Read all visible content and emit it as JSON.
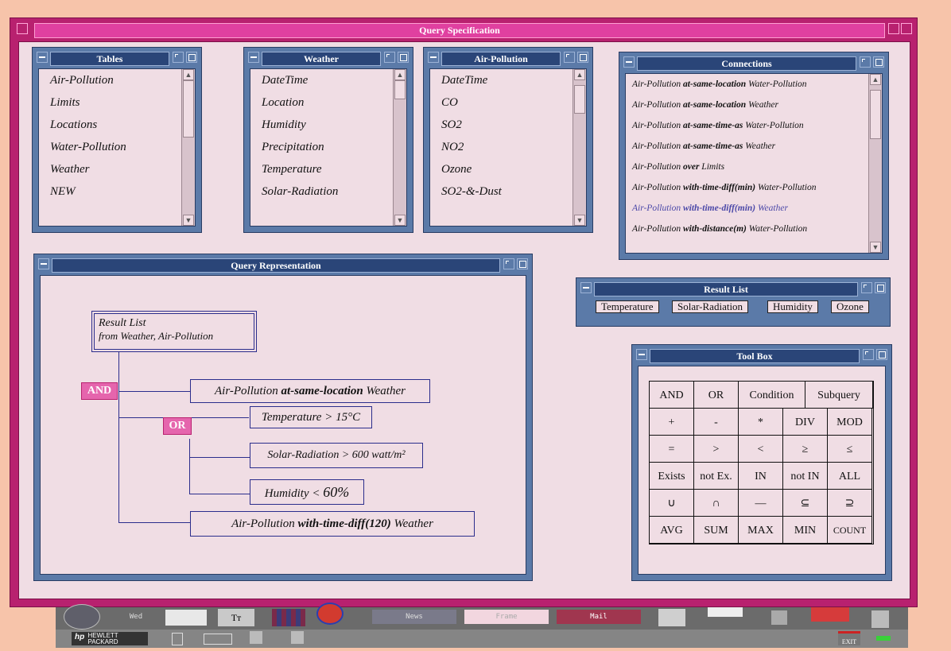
{
  "window": {
    "title": "Query Specification"
  },
  "tables": {
    "title": "Tables",
    "items": [
      "Air-Pollution",
      "Limits",
      "Locations",
      "Water-Pollution",
      "Weather",
      "NEW"
    ]
  },
  "weather": {
    "title": "Weather",
    "items": [
      "DateTime",
      "Location",
      "Humidity",
      "Precipitation",
      "Temperature",
      "Solar-Radiation"
    ]
  },
  "air_pollution": {
    "title": "Air-Pollution",
    "items": [
      "DateTime",
      "CO",
      "SO2",
      "NO2",
      "Ozone",
      "SO2-&-Dust"
    ]
  },
  "connections": {
    "title": "Connections",
    "items": [
      {
        "a": "Air-Pollution",
        "rel": "at-same-location",
        "b": "Water-Pollution"
      },
      {
        "a": "Air-Pollution",
        "rel": "at-same-location",
        "b": "Weather"
      },
      {
        "a": "Air-Pollution",
        "rel": "at-same-time-as",
        "b": "Water-Pollution"
      },
      {
        "a": "Air-Pollution",
        "rel": "at-same-time-as",
        "b": "Weather"
      },
      {
        "a": "Air-Pollution",
        "rel": "over",
        "b": "Limits"
      },
      {
        "a": "Air-Pollution",
        "rel": "with-time-diff(min)",
        "b": "Water-Pollution"
      },
      {
        "a": "Air-Pollution",
        "rel": "with-time-diff(min)",
        "b": "Weather"
      },
      {
        "a": "Air-Pollution",
        "rel": "with-distance(m)",
        "b": "Water-Pollution"
      }
    ]
  },
  "query": {
    "title": "Query Representation",
    "result_line1": "Result List",
    "result_line2": "from Weather, Air-Pollution",
    "and_label": "AND",
    "or_label": "OR",
    "cond1_a": "Air-Pollution",
    "cond1_rel": "at-same-location",
    "cond1_b": "Weather",
    "cond2": "Temperature > 15°C",
    "cond3": "Solar-Radiation > 600 watt/m²",
    "cond4a": "Humidity < ",
    "cond4b": "60%",
    "cond5_a": "Air-Pollution",
    "cond5_rel": "with-time-diff(120)",
    "cond5_b": "Weather"
  },
  "result_list": {
    "title": "Result List",
    "items": [
      "Temperature",
      "Solar-Radiation",
      "Humidity",
      "Ozone"
    ]
  },
  "toolbox": {
    "title": "Tool Box",
    "row1": [
      "AND",
      "OR",
      "Condition",
      "Subquery"
    ],
    "rows": [
      [
        "+",
        "-",
        "*",
        "DIV",
        "MOD"
      ],
      [
        "=",
        ">",
        "<",
        "≥",
        "≤"
      ],
      [
        "Exists",
        "not Ex.",
        "IN",
        "not IN",
        "ALL"
      ],
      [
        "∪",
        "∩",
        "—",
        "⊆",
        "⊇"
      ],
      [
        "AVG",
        "SUM",
        "MAX",
        "MIN",
        "COUNT"
      ]
    ]
  },
  "taskbar": {
    "day": "Wed",
    "news": "News",
    "frame": "Frame",
    "mail": "Mail",
    "exit": "EXIT",
    "brand1": "HEWLETT",
    "brand2": "PACKARD",
    "hp": "hp"
  }
}
